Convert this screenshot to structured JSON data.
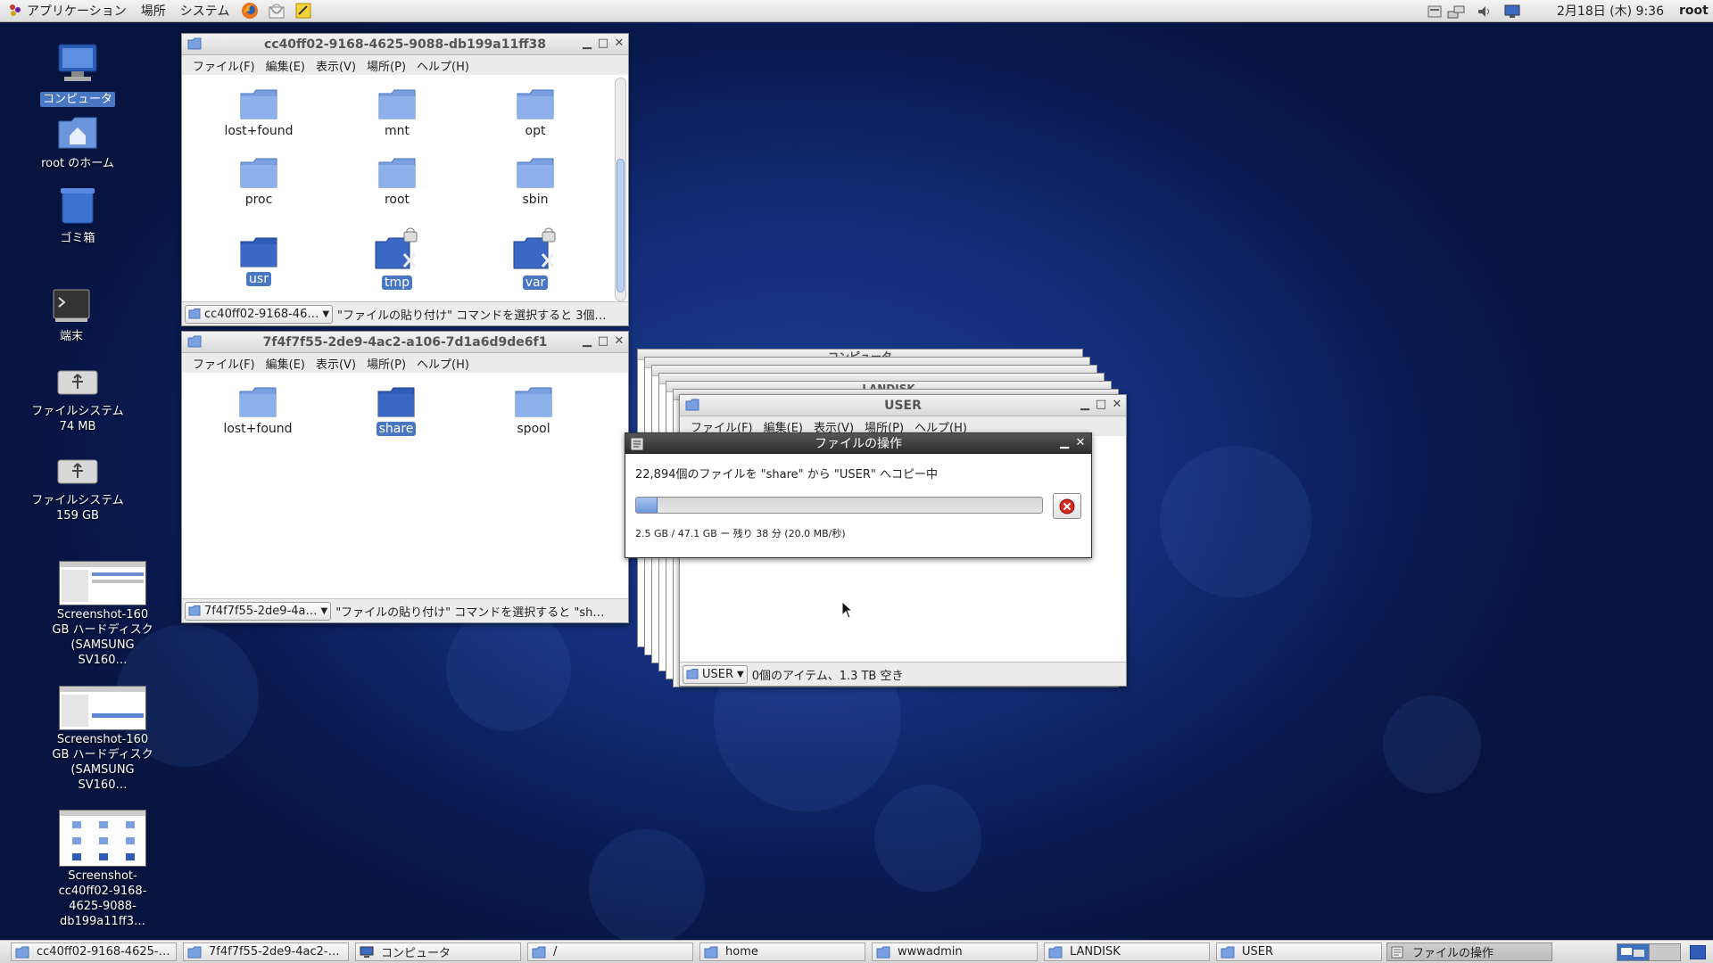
{
  "top_panel": {
    "menus": [
      "アプリケーション",
      "場所",
      "システム"
    ],
    "clock": "2月18日 (木)  9:36",
    "user": "root"
  },
  "desktop_icons": [
    {
      "label": "コンピュータ",
      "icon": "computer-icon",
      "selected": true
    },
    {
      "label": "root のホーム",
      "icon": "home-folder-icon"
    },
    {
      "label": "ゴミ箱",
      "icon": "trash-icon"
    },
    {
      "label": "端末",
      "icon": "terminal-icon"
    },
    {
      "label": "ファイルシステム 74 MB",
      "icon": "usb-drive-icon"
    },
    {
      "label": "ファイルシステム 159 GB",
      "icon": "usb-drive-icon"
    },
    {
      "label": "Screenshot-160 GB ハードディスク (SAMSUNG SV160…",
      "icon": "image-thumbnail-icon"
    },
    {
      "label": "Screenshot-160 GB ハードディスク (SAMSUNG SV160…",
      "icon": "image-thumbnail-icon"
    },
    {
      "label": "Screenshot-cc40ff02-9168-4625-9088-db199a11ff3…",
      "icon": "image-thumbnail-icon"
    }
  ],
  "window1": {
    "title": "cc40ff02-9168-4625-9088-db199a11ff38",
    "menus": [
      "ファイル(F)",
      "編集(E)",
      "表示(V)",
      "場所(P)",
      "ヘルプ(H)"
    ],
    "items": [
      {
        "name": "lost+found"
      },
      {
        "name": "mnt"
      },
      {
        "name": "opt"
      },
      {
        "name": "proc"
      },
      {
        "name": "root"
      },
      {
        "name": "sbin"
      },
      {
        "name": "usr",
        "selected": true
      },
      {
        "name": "tmp",
        "selected": true,
        "locked": true
      },
      {
        "name": "var",
        "selected": true,
        "locked": true
      }
    ],
    "path": "cc40ff02-9168-46…",
    "status": "\"ファイルの貼り付け\" コマンドを選択すると 3個…"
  },
  "window2": {
    "title": "7f4f7f55-2de9-4ac2-a106-7d1a6d9de6f1",
    "menus": [
      "ファイル(F)",
      "編集(E)",
      "表示(V)",
      "場所(P)",
      "ヘルプ(H)"
    ],
    "items": [
      {
        "name": "lost+found"
      },
      {
        "name": "share",
        "selected": true
      },
      {
        "name": "spool"
      }
    ],
    "path": "7f4f7f55-2de9-4a…",
    "status": "\"ファイルの貼り付け\" コマンドを選択すると \"sh…"
  },
  "window_user": {
    "title": "USER",
    "menus": [
      "ファイル(F)",
      "編集(E)",
      "表示(V)",
      "場所(P)",
      "ヘルプ(H)"
    ],
    "path": "USER",
    "status": "0個のアイテム、1.3 TB 空き"
  },
  "stack_titles": [
    "コンピュータ",
    "LANDISK"
  ],
  "file_op": {
    "title": "ファイルの操作",
    "message": "22,894個のファイルを \"share\" から \"USER\" へコピー中",
    "progress": 0.053,
    "detail": "2.5 GB / 47.1 GB ー 残り 38 分 (20.0 MB/秒)"
  },
  "taskbar": [
    {
      "label": "cc40ff02-9168-4625-…",
      "icon": "folder"
    },
    {
      "label": "7f4f7f55-2de9-4ac2-…",
      "icon": "folder"
    },
    {
      "label": "コンピュータ",
      "icon": "computer"
    },
    {
      "label": "/",
      "icon": "folder"
    },
    {
      "label": "home",
      "icon": "folder"
    },
    {
      "label": "wwwadmin",
      "icon": "folder"
    },
    {
      "label": "LANDISK",
      "icon": "folder"
    },
    {
      "label": "USER",
      "icon": "folder"
    },
    {
      "label": "ファイルの操作",
      "icon": "dialog",
      "active": true
    }
  ],
  "colors": {
    "selection": "#4a77c4",
    "folder": "#7ba0df",
    "folder_selected": "#2f5cb8"
  }
}
